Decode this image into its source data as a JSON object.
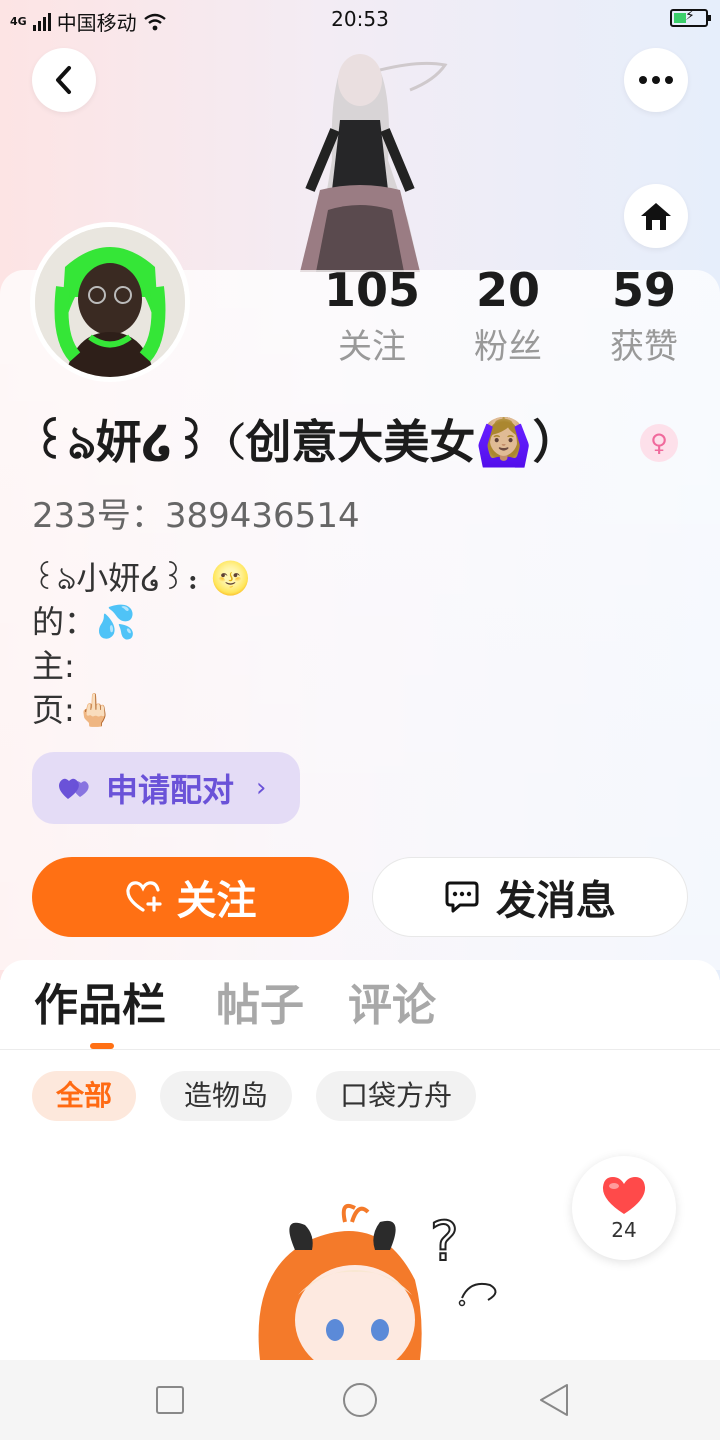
{
  "status_bar": {
    "network": "4G",
    "carrier": "中国移动",
    "time": "20:53"
  },
  "profile": {
    "stats": [
      {
        "value": "105",
        "label": "关注"
      },
      {
        "value": "20",
        "label": "粉丝"
      },
      {
        "value": "59",
        "label": "获赞"
      }
    ],
    "nickname": "꒰ঌ妍໒꒱（创意大美女🙆🏼‍♀️）",
    "gender_icon": "♀",
    "user_id": "233号：389436514",
    "bio_lines": [
      "꒰ঌ小妍໒꒱：🌝",
      "的：💦",
      "主:",
      "页:🖕🏻"
    ]
  },
  "actions": {
    "pair_label": "申请配对",
    "pair_chevron": "›",
    "follow_label": "关注",
    "message_label": "发消息"
  },
  "tabs": [
    "作品栏",
    "帖子",
    "评论"
  ],
  "filters": [
    "全部",
    "造物岛",
    "口袋方舟"
  ],
  "like_fab": {
    "count": "24"
  },
  "colors": {
    "accent": "#ff7014",
    "pair_bg": "#e4dcf6",
    "pair_text": "#6a52d8",
    "gender": "#f06a9c"
  },
  "icons": {
    "back": "chevron-left-icon",
    "more": "more-dots-icon",
    "home": "home-icon",
    "pair": "hearts-icon",
    "follow": "heart-plus-icon",
    "message": "chat-bubble-icon",
    "like": "heart-icon"
  }
}
